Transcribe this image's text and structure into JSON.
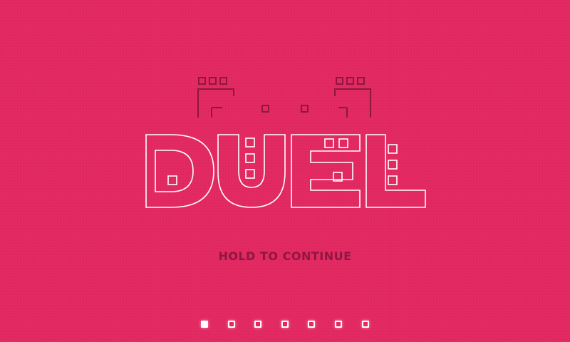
{
  "game": {
    "title": "DUEL",
    "prompt": "HOLD TO CONTINUE"
  },
  "pager": {
    "count": 7,
    "active_index": 0
  },
  "colors": {
    "background": "#e42a62",
    "title_stroke": "#ffffff",
    "character_stroke": "#8e1740",
    "prompt_text": "#8e1740",
    "dot": "#ffffff"
  }
}
